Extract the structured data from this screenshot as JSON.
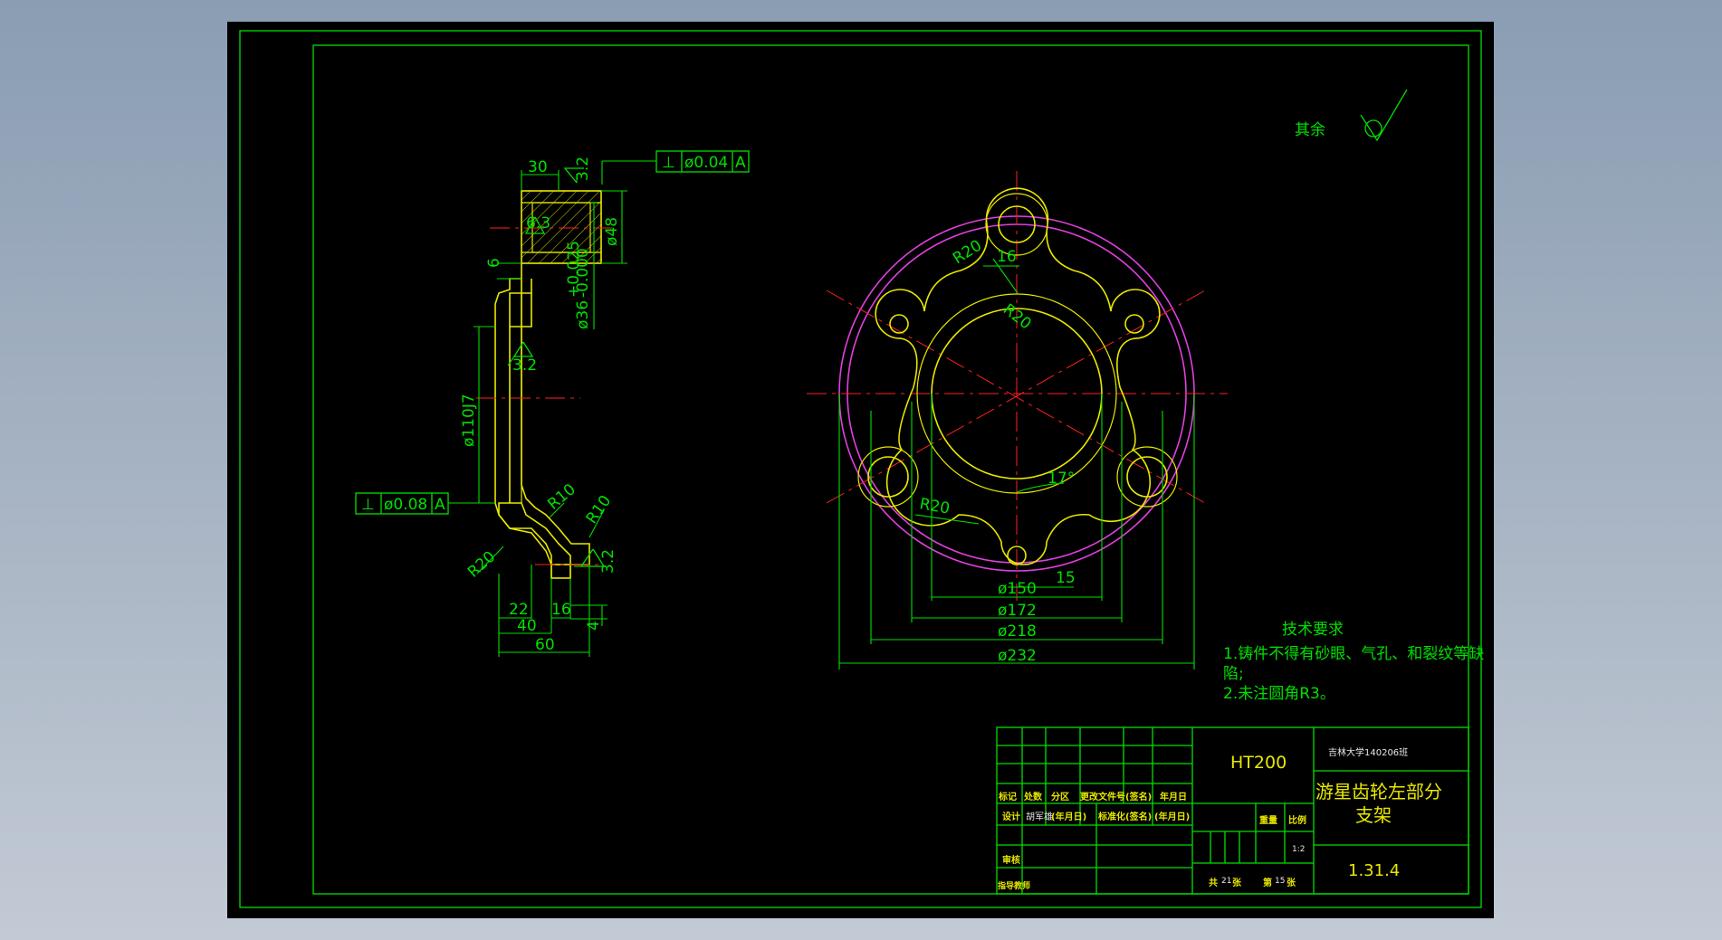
{
  "surface_roughness": {
    "other_label": "其余"
  },
  "section_view": {
    "dims": {
      "top_width": "30",
      "roughness_top": "3.2",
      "roughness_bore": "6.3",
      "outer_dia": "ø48",
      "bore_dia": "ø36",
      "bore_tol_upper": "+0.025",
      "bore_tol_lower": "-0.000",
      "step": "6",
      "roughness_mid": "3.2",
      "pilot_dia": "ø110J7",
      "r10_a": "R10",
      "r10_b": "R10",
      "r20": "R20",
      "roughness_bottom": "3.2",
      "w22": "22",
      "w16": "16",
      "w4": "4",
      "w40": "40",
      "w60": "60"
    },
    "gtol_top": {
      "symbol": "⊥",
      "value": "ø0.04",
      "datum": "A"
    },
    "gtol_left": {
      "symbol": "⊥",
      "value": "ø0.08",
      "datum": "A"
    }
  },
  "front_view": {
    "dims": {
      "r20_top": "R20",
      "w16": "16",
      "r20_inner": "R20",
      "angle": "17°",
      "r20_bottom": "R20",
      "w15": "15",
      "d150": "ø150",
      "d172": "ø172",
      "d218": "ø218",
      "d232": "ø232"
    }
  },
  "tech_requirements": {
    "title": "技术要求",
    "line1": "1.铸件不得有砂眼、气孔、和裂纹等缺",
    "line1b": "陷;",
    "line2": "2.未注圆角R3。"
  },
  "title_block": {
    "material": "HT200",
    "school": "吉林大学140206班",
    "part_name_1": "游星齿轮左部分",
    "part_name_2": "支架",
    "drawing_no": "1.31.4",
    "col_mark": "标记",
    "col_count": "处数",
    "col_zone": "分区",
    "col_change": "更改文件号(签名)",
    "col_date": "年月日",
    "row_design": "设计",
    "designer": "胡军雄",
    "design_date": "(年月日)",
    "standard": "标准化(签名)",
    "standard_date": "(年月日)",
    "mass_label": "重量",
    "scale_label": "比例",
    "scale_value": "1:2",
    "review": "审核",
    "advisor": "指导教师",
    "sheets_total_prefix": "共",
    "sheets_total": "21",
    "sheets_total_suffix": "张",
    "sheet_no_prefix": "第",
    "sheet_no": "15",
    "sheet_no_suffix": "张"
  }
}
